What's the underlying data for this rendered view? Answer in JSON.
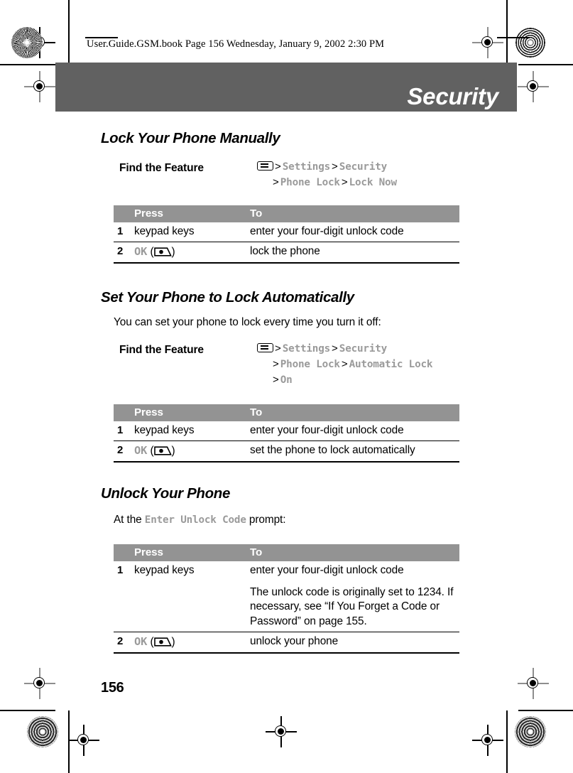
{
  "running_head": "User.Guide.GSM.book  Page 156  Wednesday, January 9, 2002  2:30 PM",
  "chapter": {
    "title": "Security"
  },
  "folio": "156",
  "colors": {
    "banner_gray": "#616161",
    "table_header_gray": "#939393",
    "screen_text_gray": "#9a9a9a"
  },
  "icons": {
    "menu_key": "menu-key-icon",
    "soft_key": "soft-key-icon"
  },
  "sections": [
    {
      "heading": "Lock Your Phone Manually",
      "find_the_feature": {
        "label": "Find the Feature",
        "lines": [
          {
            "icon": "menu-key-icon",
            "items": [
              "Settings",
              "Security"
            ]
          },
          {
            "icon": null,
            "items": [
              "Phone Lock",
              "Lock Now"
            ]
          }
        ]
      },
      "table": {
        "headers": [
          "Press",
          "To"
        ],
        "rows": [
          {
            "num": "1",
            "press": "keypad keys",
            "press_mono": false,
            "to": "enter your four-digit unlock code",
            "note": null
          },
          {
            "num": "2",
            "press": "OK",
            "press_mono": true,
            "to": "lock the phone",
            "note": null
          }
        ]
      }
    },
    {
      "heading": "Set Your Phone to Lock Automatically",
      "paragraph": "You can set your phone to lock every time you turn it off:",
      "find_the_feature": {
        "label": "Find the Feature",
        "lines": [
          {
            "icon": "menu-key-icon",
            "items": [
              "Settings",
              "Security"
            ]
          },
          {
            "icon": null,
            "items": [
              "Phone Lock",
              "Automatic Lock"
            ]
          },
          {
            "icon": null,
            "items": [
              "On"
            ]
          }
        ]
      },
      "table": {
        "headers": [
          "Press",
          "To"
        ],
        "rows": [
          {
            "num": "1",
            "press": "keypad keys",
            "press_mono": false,
            "to": "enter your four-digit unlock code",
            "note": null
          },
          {
            "num": "2",
            "press": "OK",
            "press_mono": true,
            "to": "set the phone to lock automatically",
            "note": null
          }
        ]
      }
    },
    {
      "heading": "Unlock Your Phone",
      "paragraph_parts": {
        "before": "At the ",
        "mono": "Enter Unlock Code",
        "after": " prompt:"
      },
      "table": {
        "headers": [
          "Press",
          "To"
        ],
        "rows": [
          {
            "num": "1",
            "press": "keypad keys",
            "press_mono": false,
            "to": "enter your four-digit unlock code",
            "note": "The unlock code is originally set to 1234. If necessary, see “If You Forget a Code or Password” on page 155."
          },
          {
            "num": "2",
            "press": "OK",
            "press_mono": true,
            "to": "unlock your phone",
            "note": null
          }
        ]
      }
    }
  ]
}
